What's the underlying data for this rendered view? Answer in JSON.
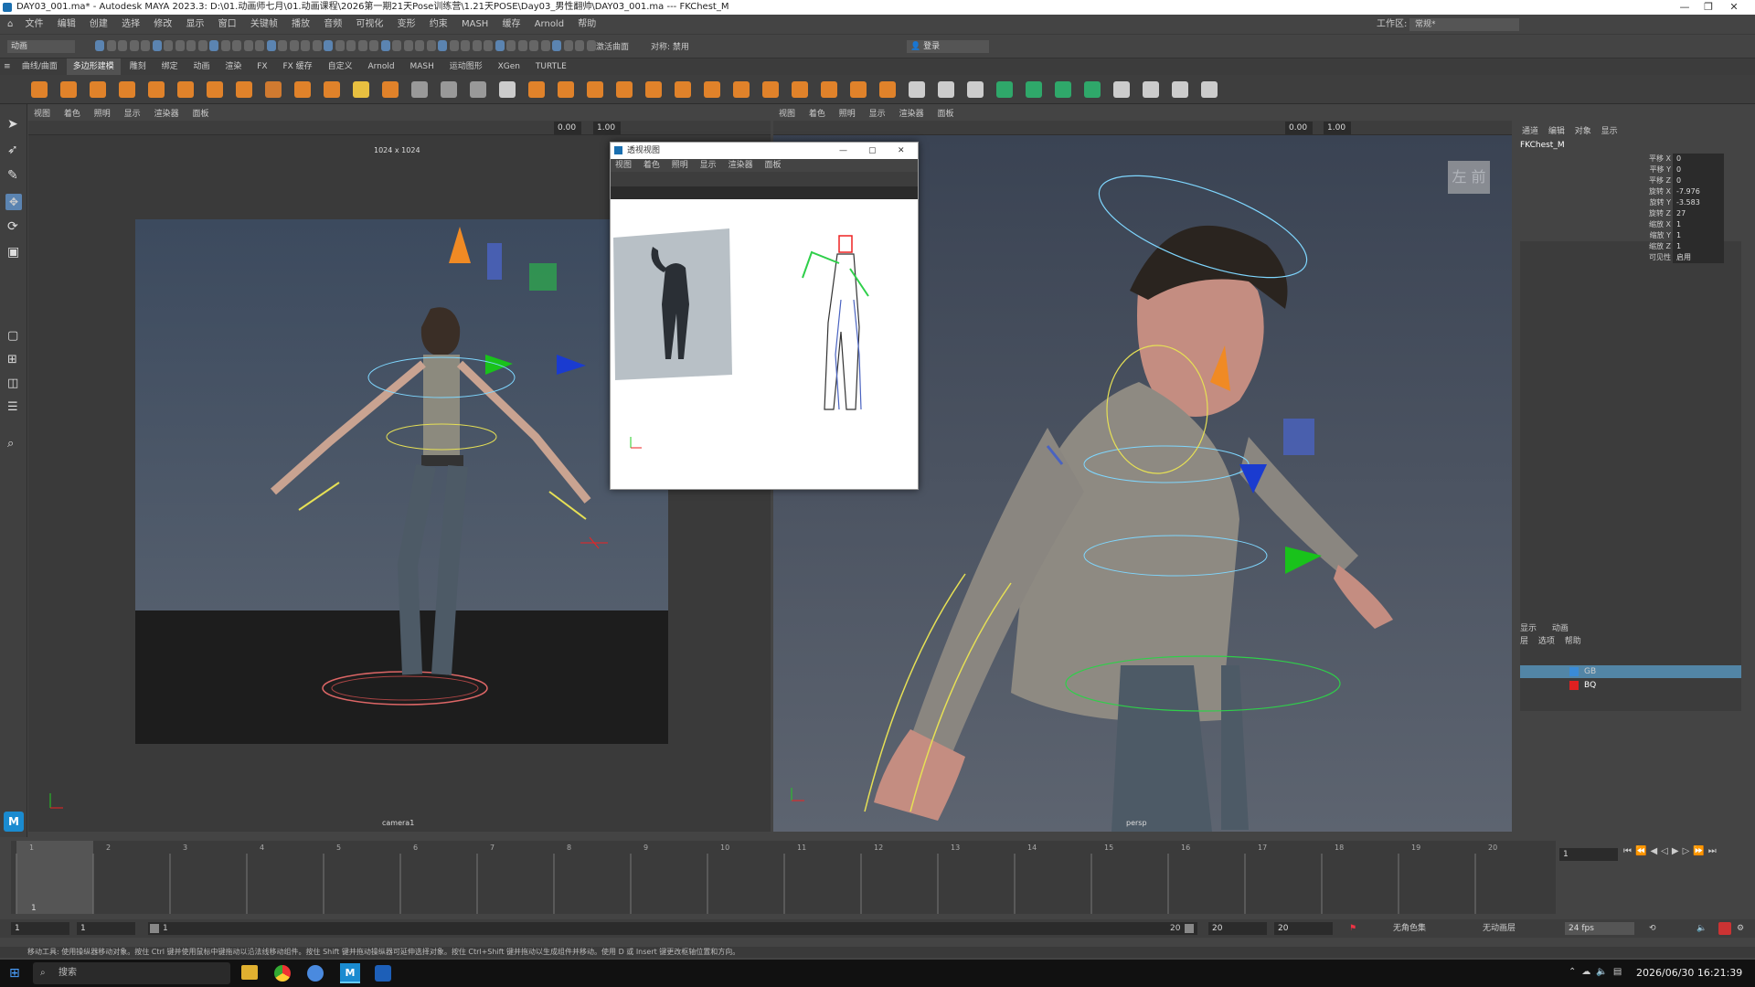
{
  "window": {
    "title": "DAY03_001.ma* - Autodesk MAYA 2023.3: D:\\01.动画师七月\\01.动画课程\\2026第一期21天Pose训练营\\1.21天POSE\\Day03_男性翻帅\\DAY03_001.ma --- FKChest_M"
  },
  "menu": [
    "文件",
    "编辑",
    "创建",
    "选择",
    "修改",
    "显示",
    "窗口",
    "关键帧",
    "播放",
    "音频",
    "可视化",
    "变形",
    "约束",
    "MASH",
    "缓存",
    "Arnold",
    "帮助"
  ],
  "workspace": {
    "label": "工作区:",
    "value": "常规*"
  },
  "statusline": {
    "mode": "动画",
    "field1": "无激活曲面",
    "field2": "对称: 禁用",
    "login": "登录"
  },
  "shelf_tabs": [
    "曲线/曲面",
    "多边形建模",
    "雕刻",
    "绑定",
    "动画",
    "渲染",
    "FX",
    "FX 缓存",
    "自定义",
    "Arnold",
    "MASH",
    "运动图形",
    "XGen",
    "TURTLE"
  ],
  "shelf_active": "多边形建模",
  "viewport_menu": [
    "视图",
    "着色",
    "照明",
    "显示",
    "渲染器",
    "面板"
  ],
  "viewport_left": {
    "resolution": "1024 x 1024",
    "camera": "camera1",
    "val1": "0.00",
    "val2": "1.00"
  },
  "viewport_right": {
    "camera": "persp",
    "val1": "0.00",
    "val2": "1.00",
    "cube_left": "左",
    "cube_front": "前"
  },
  "float_window": {
    "title": "透视视图",
    "menu": [
      "视图",
      "着色",
      "照明",
      "显示",
      "渲染器",
      "面板"
    ]
  },
  "channel_box": {
    "tabs": [
      "通道",
      "编辑",
      "对象",
      "显示"
    ],
    "object": "FKChest_M",
    "channels": [
      {
        "name": "平移 X",
        "value": "0"
      },
      {
        "name": "平移 Y",
        "value": "0"
      },
      {
        "name": "平移 Z",
        "value": "0"
      },
      {
        "name": "旋转 X",
        "value": "-7.976"
      },
      {
        "name": "旋转 Y",
        "value": "-3.583"
      },
      {
        "name": "旋转 Z",
        "value": "27"
      },
      {
        "name": "缩放 X",
        "value": "1"
      },
      {
        "name": "缩放 Y",
        "value": "1"
      },
      {
        "name": "缩放 Z",
        "value": "1"
      },
      {
        "name": "可见性",
        "value": "启用"
      }
    ]
  },
  "layer_editor": {
    "tabs": [
      "显示",
      "动画"
    ],
    "menu": [
      "层",
      "选项",
      "帮助"
    ],
    "layers": [
      {
        "name": "GB",
        "color": "#3a8bd6"
      },
      {
        "name": "BQ",
        "color": "#e02020"
      }
    ]
  },
  "timeline": {
    "ticks": [
      "1",
      "2",
      "3",
      "4",
      "5",
      "6",
      "7",
      "8",
      "9",
      "10",
      "11",
      "12",
      "13",
      "14",
      "15",
      "16",
      "17",
      "18",
      "19",
      "20"
    ],
    "current": "1",
    "current_frame_field": "1"
  },
  "range": {
    "start": "1",
    "start2": "1",
    "slider_start": "1",
    "slider_end": "20",
    "end": "20",
    "end2": "20",
    "char_set": "无角色集",
    "anim_layer": "无动画层",
    "fps": "24 fps"
  },
  "help_line": "移动工具: 使用操纵器移动对象。按住 Ctrl 键并使用鼠标中键拖动以沿法线移动组件。按住 Shift 键并拖动操纵器可延伸选择对象。按住 Ctrl+Shift 键并拖动以生成组件并移动。使用 D 或 Insert 键更改枢轴位置和方向。",
  "taskbar": {
    "search": "搜索",
    "datetime": "2026/06/30 16:21:39"
  }
}
